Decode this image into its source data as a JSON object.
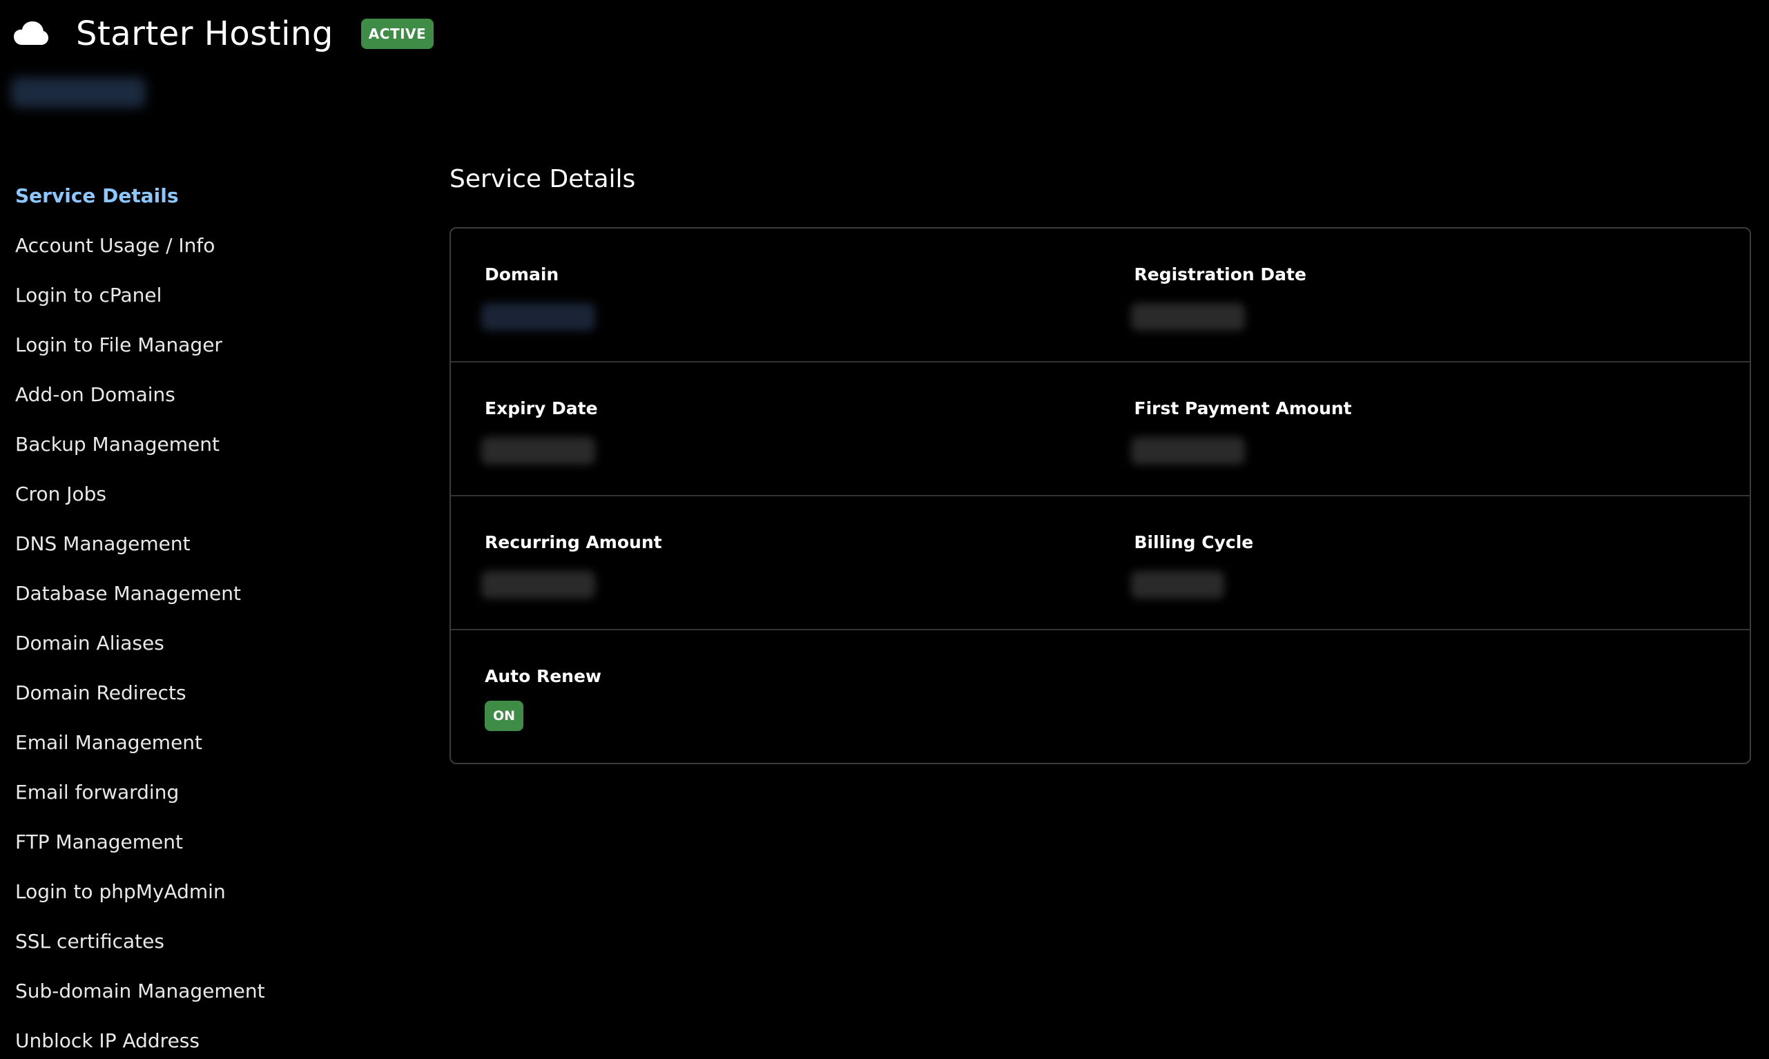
{
  "header": {
    "title": "Starter Hosting",
    "status": "ACTIVE"
  },
  "sidebar": {
    "items": [
      {
        "label": "Service Details",
        "active": true
      },
      {
        "label": "Account Usage / Info"
      },
      {
        "label": "Login to cPanel"
      },
      {
        "label": "Login to File Manager"
      },
      {
        "label": "Add-on Domains"
      },
      {
        "label": "Backup Management"
      },
      {
        "label": "Cron Jobs"
      },
      {
        "label": "DNS Management"
      },
      {
        "label": "Database Management"
      },
      {
        "label": "Domain Aliases"
      },
      {
        "label": "Domain Redirects"
      },
      {
        "label": "Email Management"
      },
      {
        "label": "Email forwarding"
      },
      {
        "label": "FTP Management"
      },
      {
        "label": "Login to phpMyAdmin"
      },
      {
        "label": "SSL certificates"
      },
      {
        "label": "Sub-domain Management"
      },
      {
        "label": "Unblock IP Address"
      }
    ]
  },
  "main": {
    "title": "Service Details",
    "fields": {
      "domain": "Domain",
      "registration_date": "Registration Date",
      "expiry_date": "Expiry Date",
      "first_payment_amount": "First Payment Amount",
      "recurring_amount": "Recurring Amount",
      "billing_cycle": "Billing Cycle",
      "auto_renew": "Auto Renew"
    },
    "auto_renew_value": "ON"
  },
  "colors": {
    "background": "#000000",
    "accent": "#8cc8ff",
    "badge_green": "#3f8c46"
  },
  "icons": {
    "logo": "cloud-icon"
  }
}
